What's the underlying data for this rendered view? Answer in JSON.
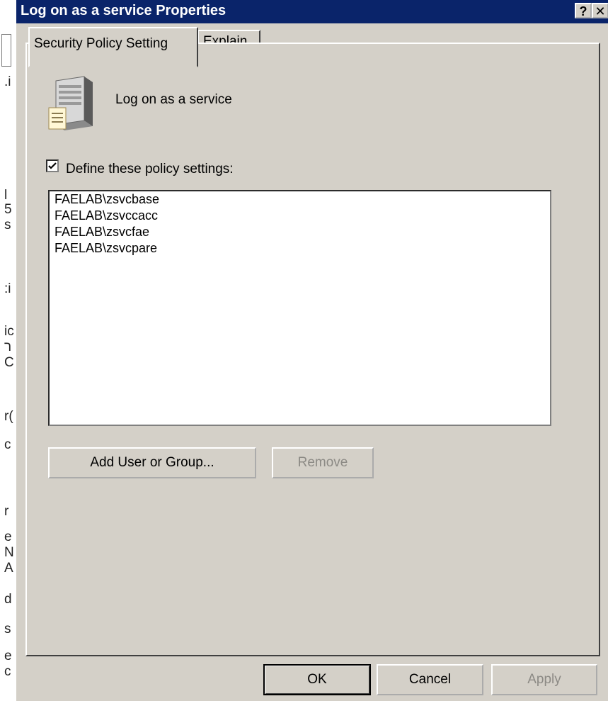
{
  "window": {
    "title": "Log on as a service Properties",
    "help_button": "?",
    "close_button": "✕"
  },
  "tabs": [
    {
      "label": "Security Policy Setting",
      "active": true
    },
    {
      "label": "Explain",
      "active": false
    }
  ],
  "policy": {
    "name": "Log on as a service",
    "icon": "server-icon"
  },
  "define_settings": {
    "label": "Define these policy settings:",
    "checked": true
  },
  "accounts": [
    "FAELAB\\zsvcbase",
    "FAELAB\\zsvccacc",
    "FAELAB\\zsvcfae",
    "FAELAB\\zsvcpare"
  ],
  "buttons": {
    "add": "Add User or Group...",
    "remove": "Remove",
    "ok": "OK",
    "cancel": "Cancel",
    "apply": "Apply"
  },
  "background_fragments": [
    ".i",
    "l",
    "5",
    "s",
    ":i",
    "ic",
    "ר",
    "C",
    "r(",
    "c",
    "r",
    "e",
    "N",
    "A",
    "d",
    "s",
    "e",
    "c"
  ],
  "colors": {
    "titlebar": "#0a246a",
    "face": "#d4d0c8",
    "disabled_text": "#8c8a85"
  }
}
